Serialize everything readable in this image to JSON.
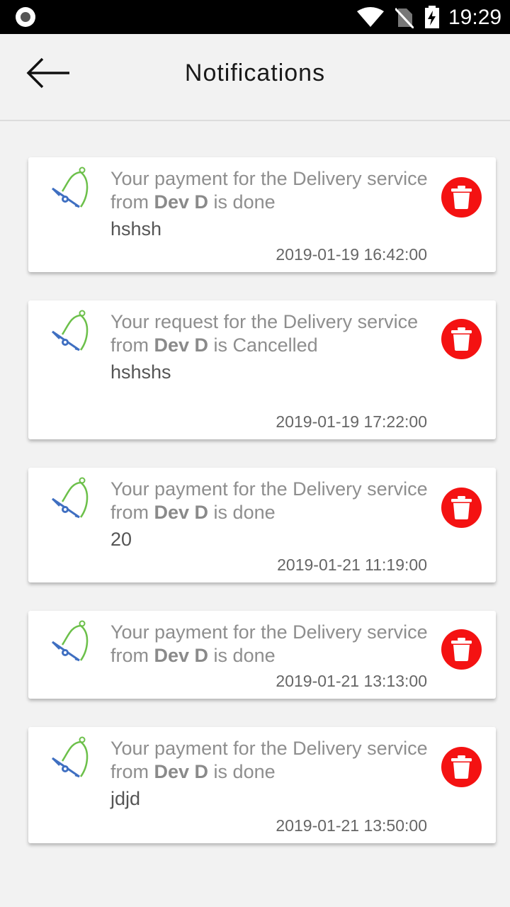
{
  "status_bar": {
    "time": "19:29"
  },
  "header": {
    "title": "Notifications"
  },
  "notifications": [
    {
      "prefix": "Your payment for the Delivery service from ",
      "sender": "Dev D",
      "suffix": " is done",
      "detail": "hshsh",
      "timestamp": "2019-01-19 16:42:00"
    },
    {
      "prefix": "Your request for the Delivery service from ",
      "sender": "Dev D",
      "suffix": " is Cancelled",
      "detail": "hshshs",
      "timestamp": "2019-01-19 17:22:00"
    },
    {
      "prefix": "Your payment for the Delivery service from ",
      "sender": "Dev D",
      "suffix": " is done",
      "detail": "20",
      "timestamp": "2019-01-21 11:19:00"
    },
    {
      "prefix": "Your payment for the Delivery service from ",
      "sender": "Dev D",
      "suffix": " is done",
      "detail": "",
      "timestamp": "2019-01-21 13:13:00"
    },
    {
      "prefix": "Your payment for the Delivery service from ",
      "sender": "Dev D",
      "suffix": " is done",
      "detail": "jdjd",
      "timestamp": "2019-01-21 13:50:00"
    }
  ],
  "colors": {
    "delete": "#f41212",
    "bell_green": "#6cc04a",
    "bell_blue": "#3f6fc1"
  },
  "icons": {
    "back": "arrow-left-icon",
    "bell": "bell-icon",
    "delete": "trash-icon"
  }
}
